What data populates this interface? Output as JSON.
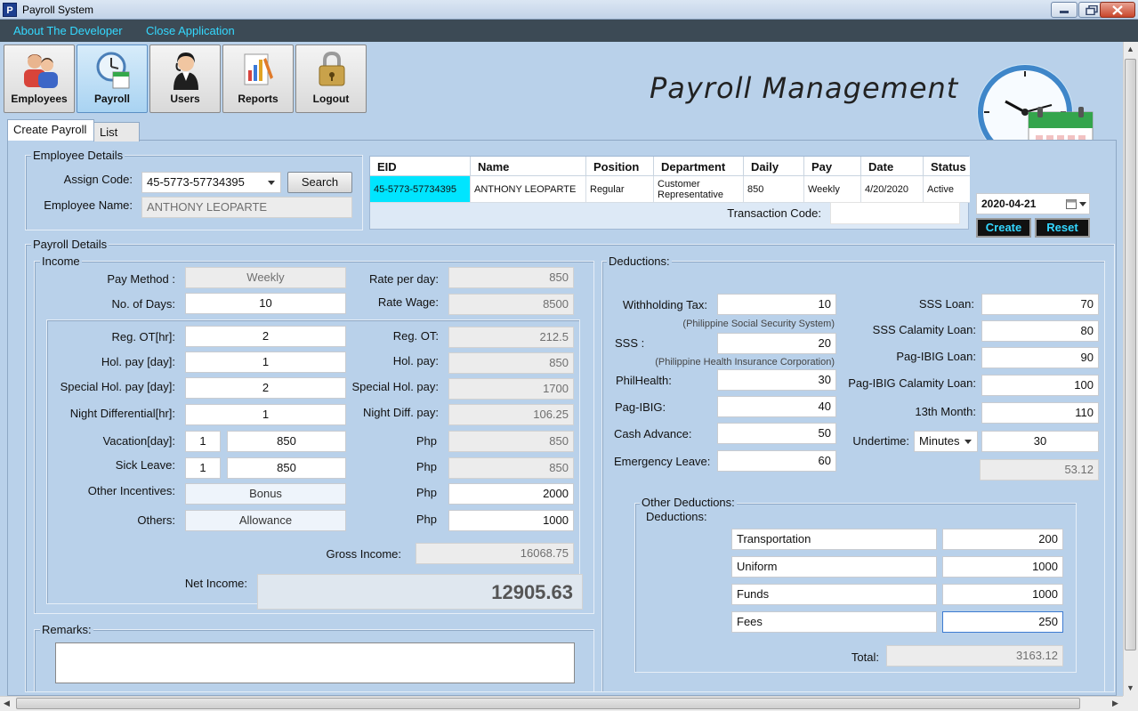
{
  "window": {
    "title": "Payroll System",
    "icon_letter": "P"
  },
  "menu": {
    "about": "About The Developer",
    "close": "Close Application"
  },
  "nav": [
    {
      "label": "Employees",
      "icon": "employees-icon"
    },
    {
      "label": "Payroll",
      "icon": "payroll-clock-icon"
    },
    {
      "label": "Users",
      "icon": "user-headset-icon"
    },
    {
      "label": "Reports",
      "icon": "reports-icon"
    },
    {
      "label": "Logout",
      "icon": "logout-lock-icon"
    }
  ],
  "header": {
    "title": "Payroll Management"
  },
  "tabs": {
    "create": "Create Payroll",
    "list": "List"
  },
  "employee_details": {
    "title": "Employee Details",
    "assign_code_label": "Assign Code:",
    "assign_code_value": "45-5773-57734395",
    "search_label": "Search",
    "employee_name_label": "Employee Name:",
    "employee_name_value": "ANTHONY LEOPARTE"
  },
  "grid": {
    "columns": [
      "EID",
      "Name",
      "Position",
      "Department",
      "Daily",
      "Pay",
      "Date",
      "Status"
    ],
    "row": [
      "45-5773-57734395",
      "ANTHONY LEOPARTE",
      "Regular",
      "Customer Representative",
      "850",
      "Weekly",
      "4/20/2020",
      "Active"
    ],
    "highlight_color": "#00e5ff"
  },
  "transaction": {
    "label": "Transaction Code:",
    "value": ""
  },
  "date_picker": {
    "value": "2020-04-21"
  },
  "actions": {
    "create": "Create",
    "reset": "Reset"
  },
  "payroll_details": {
    "title": "Payroll Details"
  },
  "income": {
    "title": "Income",
    "pay_method_label": "Pay Method  :",
    "pay_method_value": "Weekly",
    "days_label": "No. of Days:",
    "days_value": "10",
    "rate_per_day_label": "Rate per day:",
    "rate_per_day_value": "850",
    "rate_wage_label": "Rate Wage:",
    "rate_wage_value": "8500",
    "reg_ot_hr_label": "Reg. OT[hr]:",
    "reg_ot_hr_value": "2",
    "reg_ot_label": "Reg. OT:",
    "reg_ot_value": "212.5",
    "hol_day_label": "Hol. pay [day]:",
    "hol_day_value": "1",
    "hol_pay_label": "Hol. pay:",
    "hol_pay_value": "850",
    "spec_day_label": "Special Hol. pay [day]:",
    "spec_day_value": "2",
    "spec_pay_label": "Special Hol. pay:",
    "spec_pay_value": "1700",
    "night_hr_label": "Night Differential[hr]:",
    "night_hr_value": "1",
    "night_pay_label": "Night Diff. pay:",
    "night_pay_value": "106.25",
    "vacation_label": "Vacation[day]:",
    "vacation_days": "1",
    "vacation_rate": "850",
    "vacation_php_label": "Php",
    "vacation_php_value": "850",
    "sick_label": "Sick Leave:",
    "sick_days": "1",
    "sick_rate": "850",
    "sick_php_label": "Php",
    "sick_php_value": "850",
    "other_inc_label": "Other Incentives:",
    "other_inc_name": "Bonus",
    "other_inc_php_label": "Php",
    "other_inc_value": "2000",
    "others_label": "Others:",
    "others_name": "Allowance",
    "others_php_label": "Php",
    "others_value": "1000",
    "gross_label": "Gross Income:",
    "gross_value": "16068.75"
  },
  "net_income": {
    "label": "Net Income:",
    "value": "12905.63"
  },
  "remarks": {
    "label": "Remarks:",
    "value": ""
  },
  "deductions": {
    "title": "Deductions:",
    "withholding_label": "Withholding Tax:",
    "withholding_value": "10",
    "sss_note": "(Philippine Social Security System)",
    "sss_label": "SSS :",
    "sss_value": "20",
    "philhealth_note": "(Philippine Health Insurance Corporation)",
    "philhealth_label": "PhilHealth:",
    "philhealth_value": "30",
    "pagibig_label": "Pag-IBIG:",
    "pagibig_value": "40",
    "cash_adv_label": "Cash Advance:",
    "cash_adv_value": "50",
    "emergency_label": "Emergency Leave:",
    "emergency_value": "60",
    "sss_loan_label": "SSS Loan:",
    "sss_loan_value": "70",
    "sss_cal_label": "SSS Calamity Loan:",
    "sss_cal_value": "80",
    "pagibig_loan_label": "Pag-IBIG Loan:",
    "pagibig_loan_value": "90",
    "pagibig_cal_label": "Pag-IBIG Calamity Loan:",
    "pagibig_cal_value": "100",
    "month13_label": "13th Month:",
    "month13_value": "110",
    "undertime_label": "Undertime:",
    "undertime_unit": "Minutes",
    "undertime_value": "30",
    "undertime_amount": "53.12"
  },
  "other_deductions": {
    "title": "Other Deductions:",
    "subtitle": "Deductions:",
    "items": [
      {
        "name": "Transportation",
        "value": "200"
      },
      {
        "name": "Uniform",
        "value": "1000"
      },
      {
        "name": "Funds",
        "value": "1000"
      },
      {
        "name": "Fees",
        "value": "250"
      }
    ],
    "total_label": "Total:",
    "total_value": "3163.12"
  }
}
